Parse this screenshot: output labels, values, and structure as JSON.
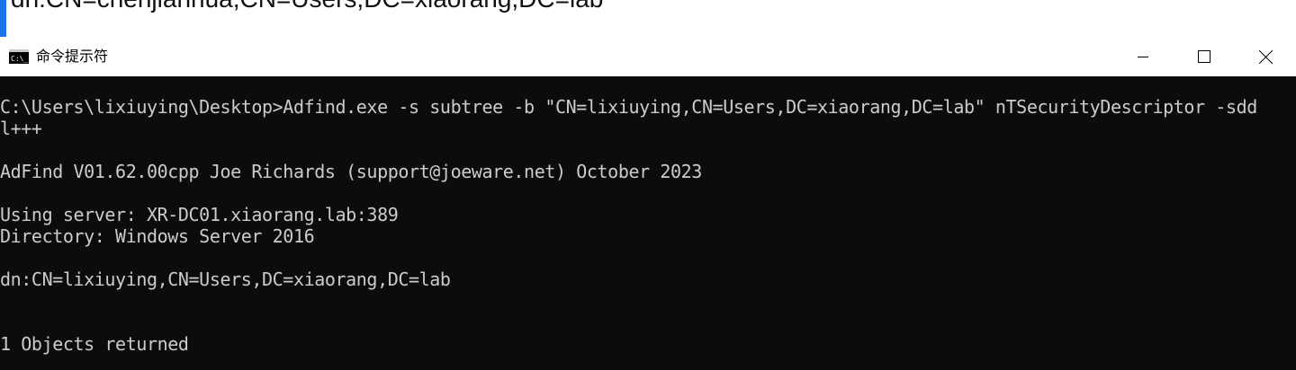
{
  "background_window": {
    "partial_text": "dn:CN=chenjianhua,CN=Users,DC=xiaorang,DC=lab"
  },
  "window": {
    "title": "命令提示符",
    "icon": "cmd-icon",
    "controls": {
      "minimize": "minimize-icon",
      "maximize": "maximize-icon",
      "close": "close-icon"
    }
  },
  "console": {
    "lines": [
      "C:\\Users\\lixiuying\\Desktop>Adfind.exe -s subtree -b \"CN=lixiuying,CN=Users,DC=xiaorang,DC=lab\" nTSecurityDescriptor -sdd",
      "l+++",
      "AdFind V01.62.00cpp Joe Richards (support@joeware.net) October 2023",
      "Using server: XR-DC01.xiaorang.lab:389",
      "Directory: Windows Server 2016",
      "dn:CN=lixiuying,CN=Users,DC=xiaorang,DC=lab",
      "1 Objects returned"
    ]
  },
  "colors": {
    "console_bg": "#0c0c0c",
    "console_fg": "#cccccc",
    "titlebar_bg": "#ffffff",
    "accent": "#1a73e8"
  }
}
